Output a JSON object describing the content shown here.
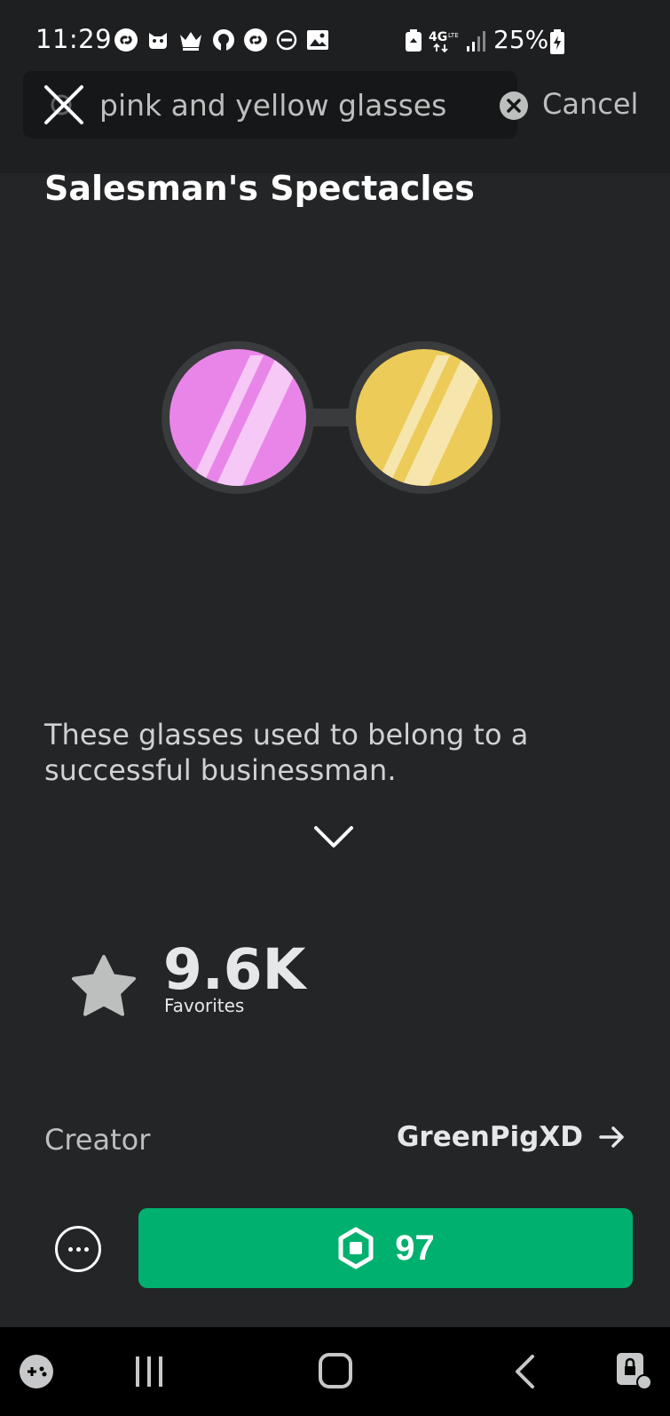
{
  "status_bar": {
    "time": "11:29",
    "battery": "25%",
    "network": "4G"
  },
  "search": {
    "query": "pink and yellow glasses",
    "cancel_label": "Cancel"
  },
  "item": {
    "title": "Salesman's Spectacles",
    "lens_colors": {
      "left": "#e985e9",
      "right": "#eccb58"
    },
    "description": "These glasses used to belong to a successful businessman.",
    "favorites_count": "9.6K",
    "favorites_label": "Favorites",
    "creator_label": "Creator",
    "creator_name": "GreenPigXD"
  },
  "purchase": {
    "price": "97",
    "currency_icon": "robux-icon",
    "accent": "#00b06f"
  },
  "nav": {
    "icons": [
      "game-controller-icon",
      "recent-apps-icon",
      "home-icon",
      "back-icon",
      "screen-lock-icon"
    ]
  }
}
